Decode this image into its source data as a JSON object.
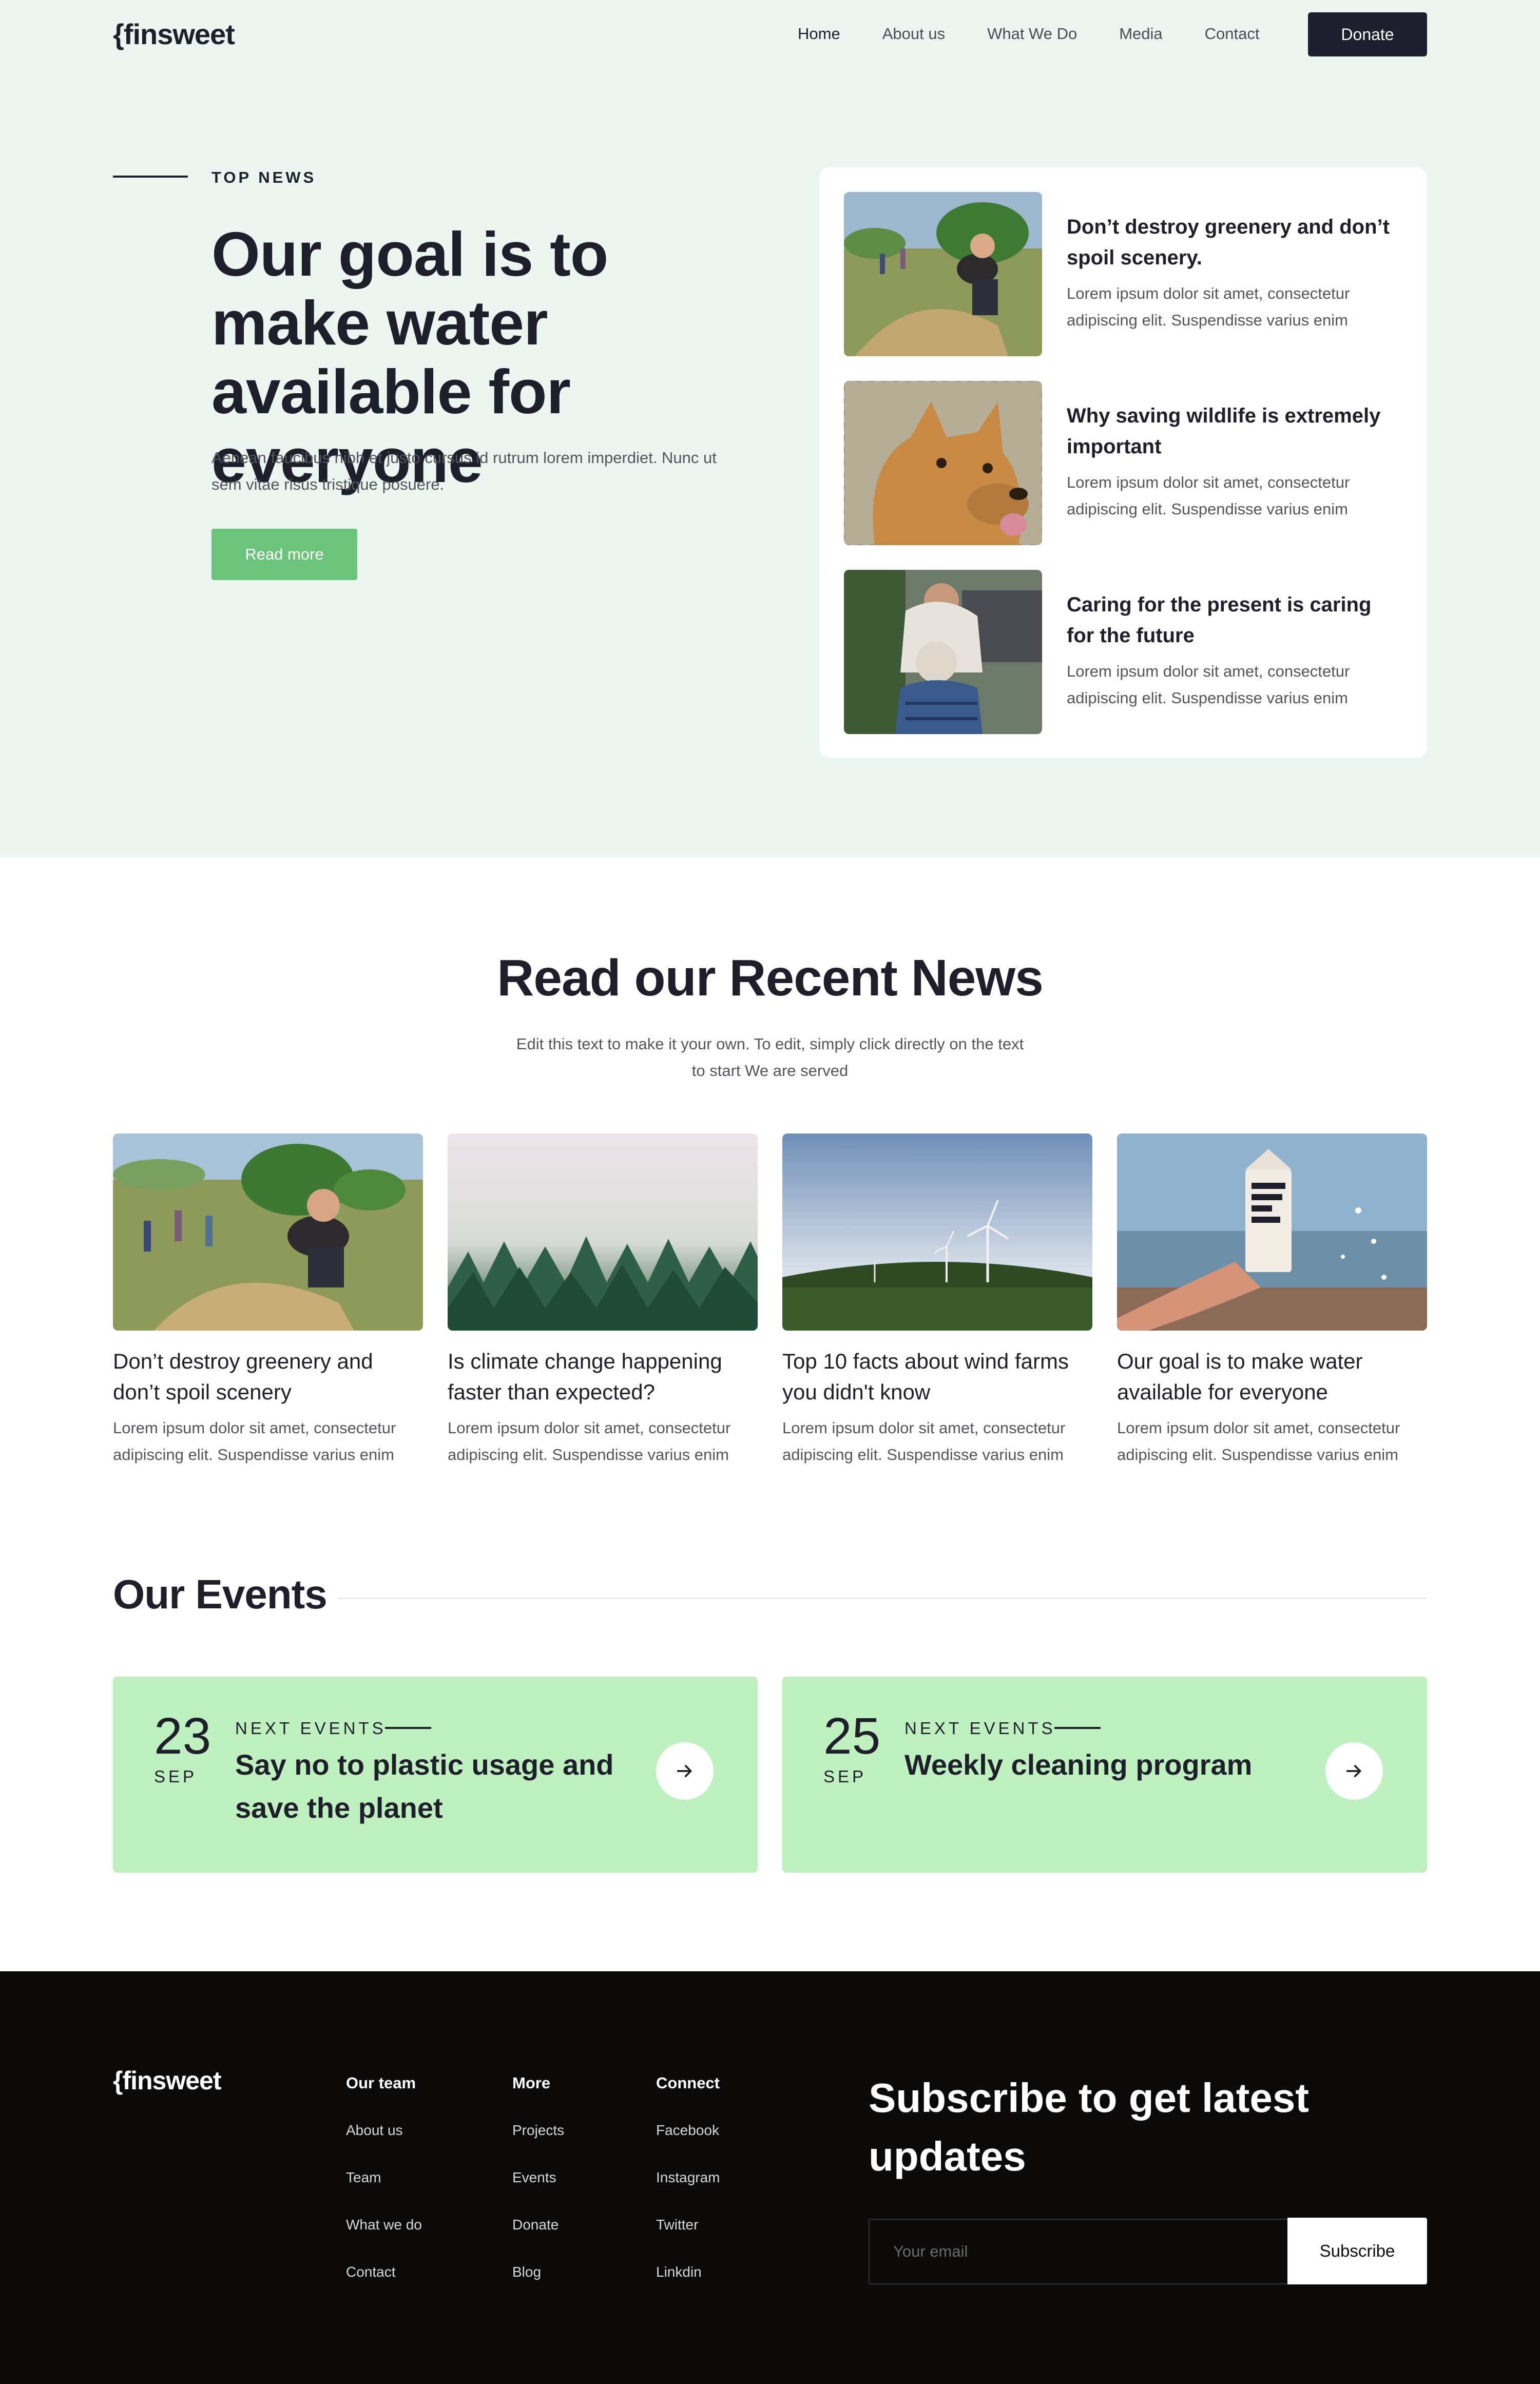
{
  "brand": {
    "logo": "{finsweet"
  },
  "nav": {
    "items": [
      "Home",
      "About us",
      "What We Do",
      "Media",
      "Contact"
    ],
    "active": "Home",
    "donate_label": "Donate"
  },
  "hero": {
    "eyebrow": "TOP NEWS",
    "title": "Our goal is to make water available for everyone",
    "text": "Aenean faucibus nibh et justo cursus id rutrum lorem imperdiet. Nunc ut sem vitae risus tristique posuere.",
    "button": "Read more"
  },
  "top_news": [
    {
      "title": "Don’t destroy greenery and don’t spoil scenery.",
      "excerpt": "Lorem ipsum dolor sit amet, consectetur adipiscing elit. Suspendisse varius enim",
      "image": "volunteer-grass-photo"
    },
    {
      "title": "Why saving wildlife is extremely important",
      "excerpt": "Lorem ipsum dolor sit amet, consectetur adipiscing elit. Suspendisse varius enim",
      "image": "dog-photo"
    },
    {
      "title": "Caring for the present is caring for the future",
      "excerpt": "Lorem ipsum dolor sit amet, consectetur adipiscing elit. Suspendisse varius enim",
      "image": "elder-care-photo"
    }
  ],
  "recent": {
    "title": "Read our Recent News",
    "subtitle": "Edit this text to make it your own. To edit, simply click directly on the text to start We are served",
    "posts": [
      {
        "title": "Don’t destroy greenery and don’t spoil scenery",
        "excerpt": "Lorem ipsum dolor sit amet, consectetur adipiscing elit. Suspendisse varius enim",
        "image": "volunteer-grass-photo"
      },
      {
        "title": " Is climate change happening faster than expected?",
        "excerpt": "Lorem ipsum dolor sit amet, consectetur adipiscing elit. Suspendisse varius enim",
        "image": "foggy-forest-photo"
      },
      {
        "title": "Top 10 facts about wind farms you didn't know",
        "excerpt": "Lorem ipsum dolor sit amet, consectetur adipiscing elit. Suspendisse varius enim",
        "image": "wind-turbines-photo"
      },
      {
        "title": "Our goal is to make water available for everyone",
        "excerpt": "Lorem ipsum dolor sit amet, consectetur adipiscing elit. Suspendisse varius enim",
        "image": "boxed-water-photo"
      }
    ]
  },
  "events": {
    "title": "Our Events",
    "items": [
      {
        "day": "23",
        "month": "SEP",
        "label": "NEXT EVENTS",
        "name": "Say no to plastic usage and save the planet"
      },
      {
        "day": "25",
        "month": "SEP",
        "label": "NEXT EVENTS",
        "name": "Weekly cleaning program"
      }
    ]
  },
  "footer": {
    "logo": "{finsweet",
    "columns": [
      {
        "heading": "Our team",
        "links": [
          "About us",
          "Team",
          "What we do",
          "Contact"
        ]
      },
      {
        "heading": "More",
        "links": [
          "Projects",
          "Events",
          "Donate",
          "Blog"
        ]
      },
      {
        "heading": "Connect",
        "links": [
          "Facebook",
          "Instagram",
          "Twitter",
          "Linkdin"
        ]
      }
    ],
    "subscribe_title": "Subscribe to get latest updates",
    "email_placeholder": "Your email",
    "subscribe_button": "Subscribe"
  },
  "colors": {
    "hero_bg": "#edf5f0",
    "accent_green": "#6cc47c",
    "event_bg": "#bff0c0",
    "dark": "#1e202d",
    "footer_bg": "#0c0909"
  }
}
